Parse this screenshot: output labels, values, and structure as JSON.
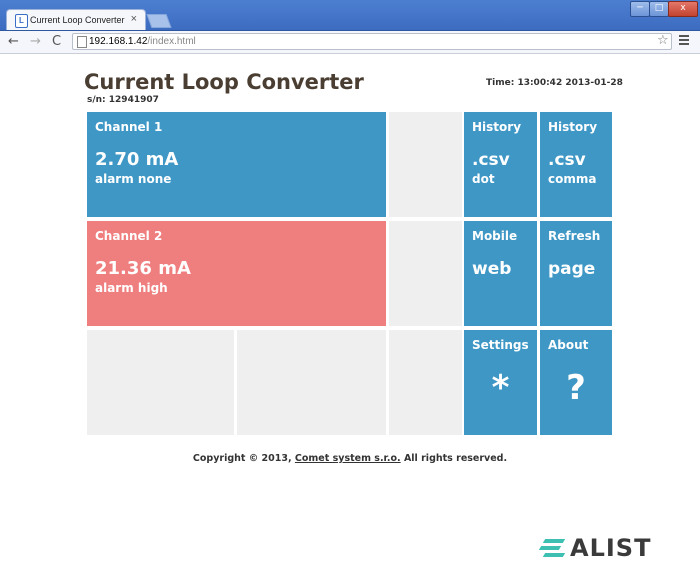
{
  "browser": {
    "tab_title": "Current Loop Converter",
    "tab_close": "×",
    "url_host": "192.168.1.42",
    "url_path": "/index.html",
    "window_buttons": {
      "minimize": "─",
      "maximize": "□",
      "close": "x"
    },
    "nav": {
      "back": "←",
      "forward": "→",
      "reload": "C"
    },
    "star": "☆"
  },
  "header": {
    "title": "Current Loop Converter",
    "serial": "s/n: 12941907",
    "time": "Time: 13:00:42 2013-01-28"
  },
  "channels": [
    {
      "label": "Channel 1",
      "value": "2.70 mA",
      "alarm": "alarm none",
      "color": "#3f97c6"
    },
    {
      "label": "Channel 2",
      "value": "21.36 mA",
      "alarm": "alarm high",
      "color": "#ef7e7e"
    }
  ],
  "tiles": {
    "history_dot": {
      "label": "History",
      "big": ".csv",
      "sub": "dot"
    },
    "history_comma": {
      "label": "History",
      "big": ".csv",
      "sub": "comma"
    },
    "mobile": {
      "label": "Mobile",
      "big": "web"
    },
    "refresh": {
      "label": "Refresh",
      "big": "page"
    },
    "settings": {
      "label": "Settings",
      "symbol": "*"
    },
    "about": {
      "label": "About",
      "symbol": "?"
    }
  },
  "footer": {
    "prefix": "Copyright © 2013,",
    "company": "Comet system s.r.o.",
    "suffix": "All rights reserved."
  },
  "watermark": {
    "text": "ALIST"
  },
  "colors": {
    "tile_blue": "#3f97c6",
    "tile_red": "#ef7e7e",
    "tile_grey": "#efefef",
    "title_brown": "#4a3e33"
  }
}
